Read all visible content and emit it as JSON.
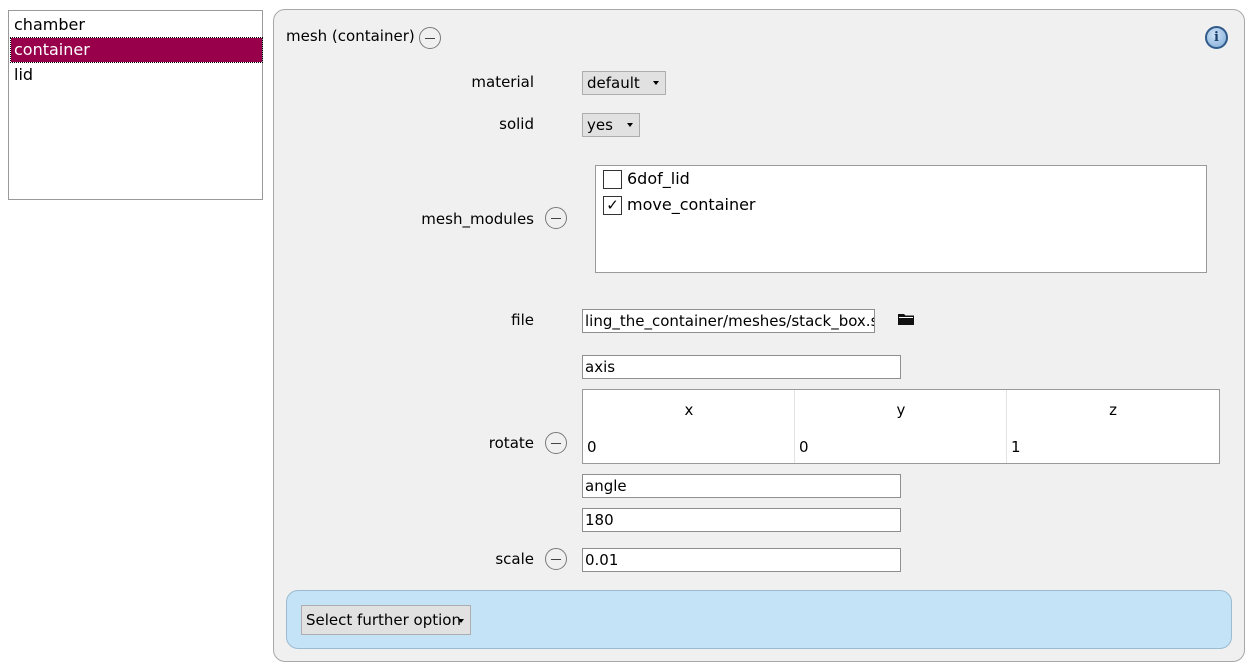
{
  "objects_list": {
    "items": [
      {
        "label": "chamber",
        "selected": false
      },
      {
        "label": "container",
        "selected": true
      },
      {
        "label": "lid",
        "selected": false
      }
    ]
  },
  "panel": {
    "title": "mesh (container)",
    "info_icon": "info-icon",
    "material": {
      "label": "material",
      "value": "default"
    },
    "solid": {
      "label": "solid",
      "value": "yes"
    },
    "mesh_modules": {
      "label": "mesh_modules",
      "items": [
        {
          "label": "6dof_lid",
          "checked": false,
          "mark": ""
        },
        {
          "label": "move_container",
          "checked": true,
          "mark": "✓"
        }
      ]
    },
    "file": {
      "label": "file",
      "value": "ling_the_container/meshes/stack_box.stl",
      "icon": "folder-icon"
    },
    "rotate": {
      "label": "rotate",
      "axis_label": "axis",
      "columns": [
        "x",
        "y",
        "z"
      ],
      "values": [
        "0",
        "0",
        "1"
      ],
      "angle_label": "angle",
      "angle_value": "180"
    },
    "scale": {
      "label": "scale",
      "value": "0.01"
    },
    "further_option": {
      "label": "Select further option"
    }
  }
}
